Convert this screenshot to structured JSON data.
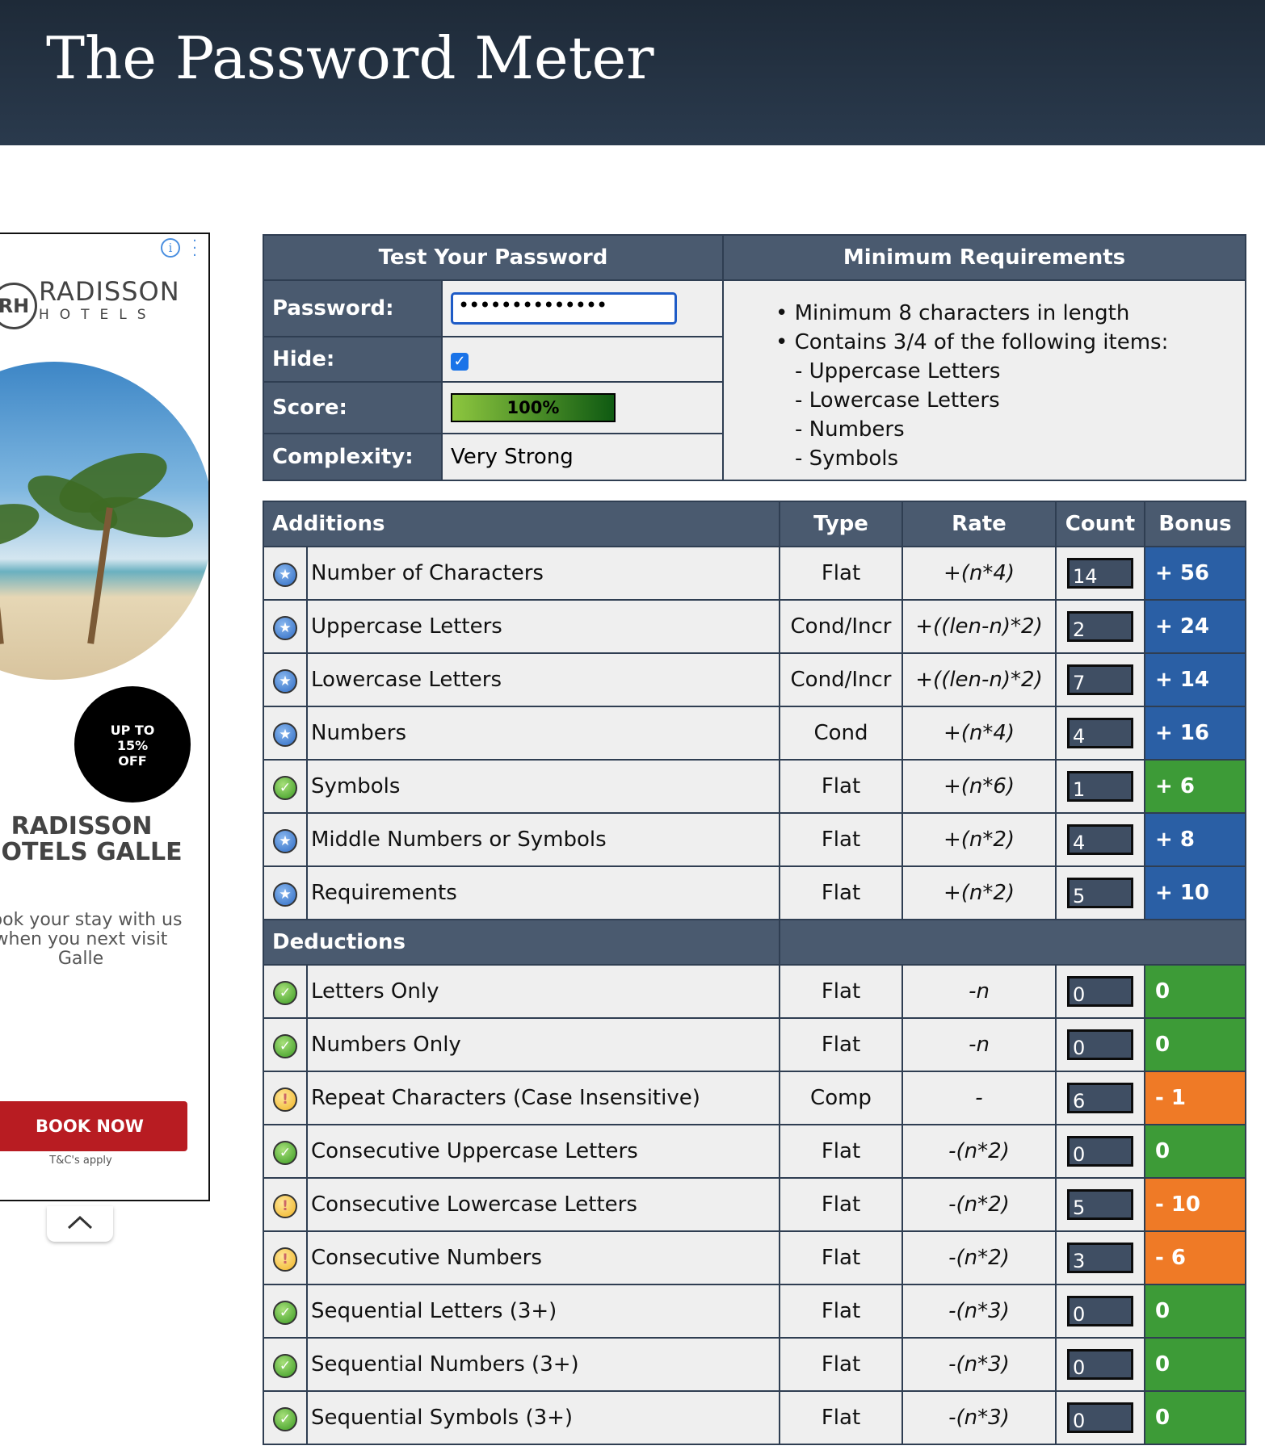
{
  "page_title": "The Password Meter",
  "ad": {
    "brand_mark": "RH",
    "brand_line1": "RADISSON",
    "brand_line2": "HOTELS",
    "badge_lines": [
      "UP TO",
      "15%",
      "OFF"
    ],
    "title_line1": "RADISSON",
    "title_line2": "HOTELS GALLE",
    "copy_line1": "Book your stay with us",
    "copy_line2": "when you next visit",
    "copy_line3": "Galle",
    "cta_label": "BOOK NOW",
    "terms": "T&C's apply",
    "info_icon": "info-icon",
    "menu_icon": "more-vertical-icon",
    "collapse_icon": "chevron-up-icon"
  },
  "test": {
    "heading": "Test Your Password",
    "password_label": "Password:",
    "password_value": "••••••••••••••",
    "hide_label": "Hide:",
    "hide_checked": true,
    "score_label": "Score:",
    "score_value": "100%",
    "score_fraction": 1.0,
    "complexity_label": "Complexity:",
    "complexity_value": "Very Strong"
  },
  "requirements": {
    "heading": "Minimum Requirements",
    "items": [
      "Minimum 8 characters in length",
      "Contains 3/4 of the following items:"
    ],
    "sub_items": [
      "- Uppercase Letters",
      "- Lowercase Letters",
      "- Numbers",
      "- Symbols"
    ]
  },
  "table": {
    "headers": {
      "additions": "Additions",
      "type": "Type",
      "rate": "Rate",
      "count": "Count",
      "bonus": "Bonus",
      "deductions": "Deductions"
    },
    "additions": [
      {
        "icon": "star-icon",
        "name": "Number of Characters",
        "type": "Flat",
        "rate": "+(n*4)",
        "count": "14",
        "bonus": "+ 56"
      },
      {
        "icon": "star-icon",
        "name": "Uppercase Letters",
        "type": "Cond/Incr",
        "rate": "+((len-n)*2)",
        "count": "2",
        "bonus": "+ 24"
      },
      {
        "icon": "star-icon",
        "name": "Lowercase Letters",
        "type": "Cond/Incr",
        "rate": "+((len-n)*2)",
        "count": "7",
        "bonus": "+ 14"
      },
      {
        "icon": "star-icon",
        "name": "Numbers",
        "type": "Cond",
        "rate": "+(n*4)",
        "count": "4",
        "bonus": "+ 16"
      },
      {
        "icon": "check-icon",
        "name": "Symbols",
        "type": "Flat",
        "rate": "+(n*6)",
        "count": "1",
        "bonus": "+ 6"
      },
      {
        "icon": "star-icon",
        "name": "Middle Numbers or Symbols",
        "type": "Flat",
        "rate": "+(n*2)",
        "count": "4",
        "bonus": "+ 8"
      },
      {
        "icon": "star-icon",
        "name": "Requirements",
        "type": "Flat",
        "rate": "+(n*2)",
        "count": "5",
        "bonus": "+ 10"
      }
    ],
    "deductions": [
      {
        "icon": "check-icon",
        "name": "Letters Only",
        "type": "Flat",
        "rate": "-n",
        "count": "0",
        "bonus": "0"
      },
      {
        "icon": "check-icon",
        "name": "Numbers Only",
        "type": "Flat",
        "rate": "-n",
        "count": "0",
        "bonus": "0"
      },
      {
        "icon": "warning-icon",
        "name": "Repeat Characters (Case Insensitive)",
        "type": "Comp",
        "rate": "-",
        "count": "6",
        "bonus": "- 1"
      },
      {
        "icon": "check-icon",
        "name": "Consecutive Uppercase Letters",
        "type": "Flat",
        "rate": "-(n*2)",
        "count": "0",
        "bonus": "0"
      },
      {
        "icon": "warning-icon",
        "name": "Consecutive Lowercase Letters",
        "type": "Flat",
        "rate": "-(n*2)",
        "count": "5",
        "bonus": "- 10"
      },
      {
        "icon": "warning-icon",
        "name": "Consecutive Numbers",
        "type": "Flat",
        "rate": "-(n*2)",
        "count": "3",
        "bonus": "- 6"
      },
      {
        "icon": "check-icon",
        "name": "Sequential Letters (3+)",
        "type": "Flat",
        "rate": "-(n*3)",
        "count": "0",
        "bonus": "0"
      },
      {
        "icon": "check-icon",
        "name": "Sequential Numbers (3+)",
        "type": "Flat",
        "rate": "-(n*3)",
        "count": "0",
        "bonus": "0"
      },
      {
        "icon": "check-icon",
        "name": "Sequential Symbols (3+)",
        "type": "Flat",
        "rate": "-(n*3)",
        "count": "0",
        "bonus": "0"
      }
    ]
  },
  "colors": {
    "header_bg": "#2a3a4d",
    "bonus_blue": "#2a5fa5",
    "bonus_green": "#3d9b37",
    "bonus_orange": "#ef7a26",
    "ad_cta": "#b81c22"
  }
}
